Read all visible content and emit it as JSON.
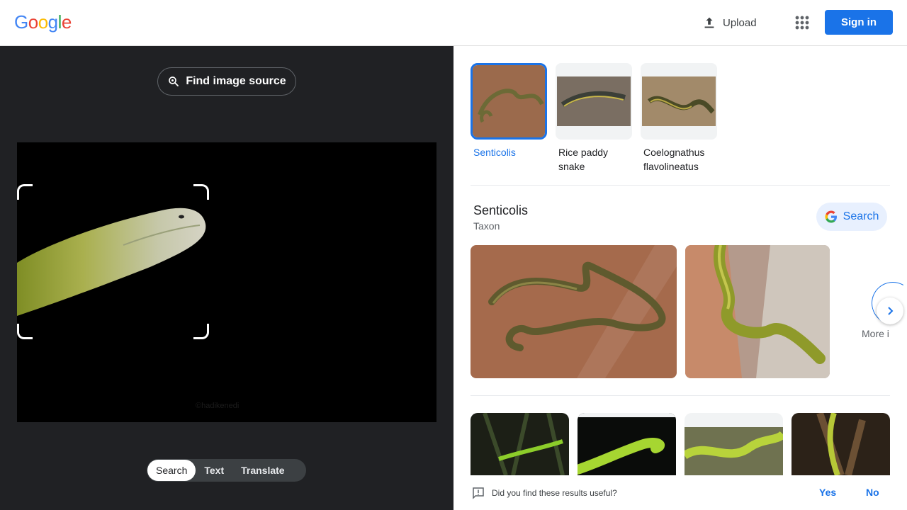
{
  "header": {
    "logo_letters": [
      {
        "ch": "G",
        "color": "#4285F4"
      },
      {
        "ch": "o",
        "color": "#EA4335"
      },
      {
        "ch": "o",
        "color": "#FBBC05"
      },
      {
        "ch": "g",
        "color": "#4285F4"
      },
      {
        "ch": "l",
        "color": "#34A853"
      },
      {
        "ch": "e",
        "color": "#EA4335"
      }
    ],
    "upload_label": "Upload",
    "signin_label": "Sign in"
  },
  "left": {
    "find_source_label": "Find image source",
    "watermark": "©hadikenedi",
    "tabs": [
      {
        "label": "Search",
        "active": true
      },
      {
        "label": "Text",
        "active": false
      },
      {
        "label": "Translate",
        "active": false
      }
    ]
  },
  "right": {
    "matches": [
      {
        "label": "Senticolis",
        "selected": true
      },
      {
        "label": "Rice paddy snake",
        "selected": false
      },
      {
        "label": "Coelognathus flavolineatus",
        "selected": false
      }
    ],
    "entity": {
      "title": "Senticolis",
      "subtitle": "Taxon",
      "search_label": "Search",
      "more_label": "More i"
    },
    "feedback": {
      "question": "Did you find these results useful?",
      "yes": "Yes",
      "no": "No"
    }
  },
  "colors": {
    "accent": "#1a73e8",
    "dark_bg": "#202124"
  }
}
